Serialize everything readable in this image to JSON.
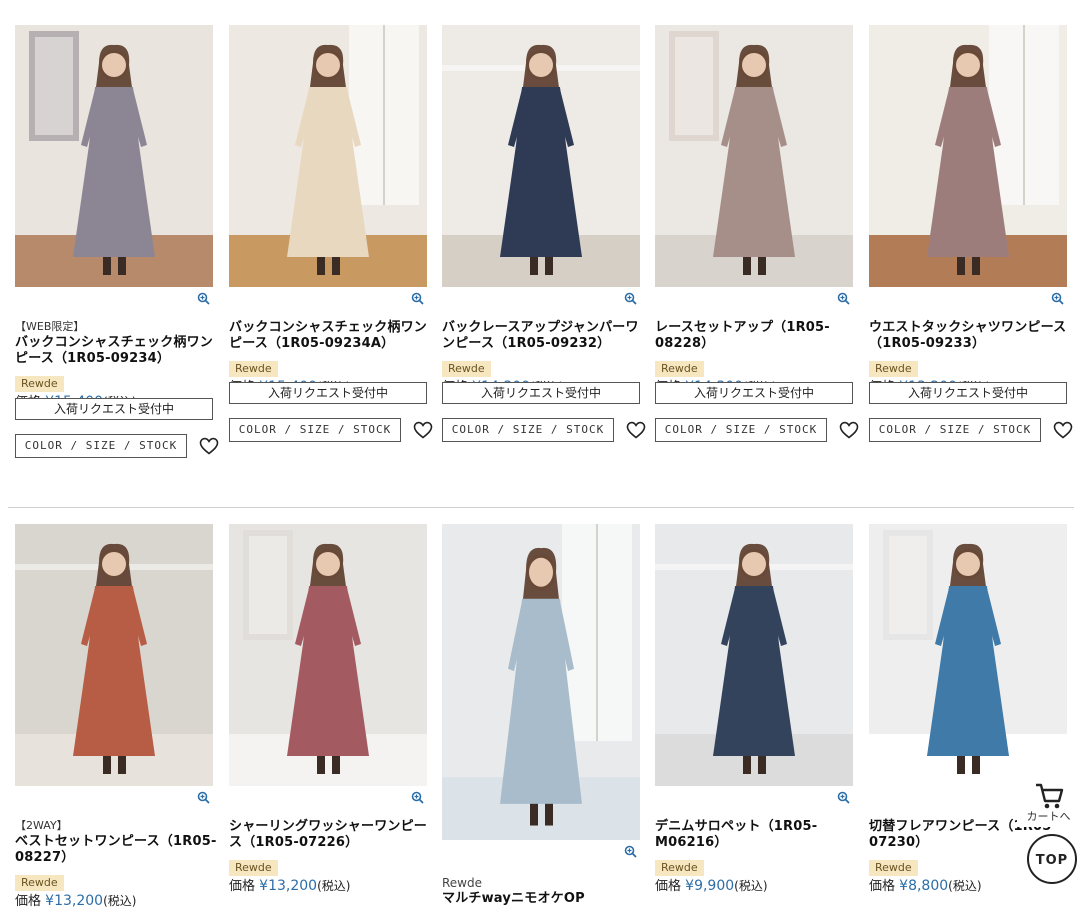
{
  "row1": [
    {
      "tag": "【WEB限定】",
      "name": "バックコンシャスチェック柄ワンピース（1R05-09234）",
      "brand": "Rewde",
      "price_prefix": "価格",
      "price": "¥15,400",
      "tax": "(税込)",
      "request": "入荷リクエスト受付中",
      "css": "COLOR / SIZE / STOCK",
      "palette": [
        "#e9e4de",
        "#8c8694",
        "#5b5060",
        "#b78a6b"
      ]
    },
    {
      "tag": "",
      "name": "バックコンシャスチェック柄ワンピース（1R05-09234A）",
      "brand": "Rewde",
      "price_prefix": "価格",
      "price": "¥15,400",
      "tax": "(税込)",
      "request": "入荷リクエスト受付中",
      "css": "COLOR / SIZE / STOCK",
      "palette": [
        "#ede8e1",
        "#e8d8bf",
        "#b59a78",
        "#c89a62"
      ]
    },
    {
      "tag": "",
      "name": "バックレースアップジャンパーワンピース（1R05-09232）",
      "brand": "Rewde",
      "price_prefix": "価格",
      "price": "¥14,300",
      "tax": "(税込)",
      "request": "入荷リクエスト受付中",
      "css": "COLOR / SIZE / STOCK",
      "palette": [
        "#eeebe6",
        "#2f3b55",
        "#a57d66",
        "#d5cfc6"
      ]
    },
    {
      "tag": "",
      "name": "レースセットアップ（1R05-08228）",
      "brand": "Rewde",
      "price_prefix": "価格",
      "price": "¥14,300",
      "tax": "(税込)",
      "request": "入荷リクエスト受付中",
      "css": "COLOR / SIZE / STOCK",
      "palette": [
        "#ebe7e2",
        "#a58f88",
        "#c9b7ae",
        "#d8d3cc"
      ]
    },
    {
      "tag": "",
      "name": "ウエストタックシャツワンピース（1R05-09233）",
      "brand": "Rewde",
      "price_prefix": "価格",
      "price": "¥13,200",
      "tax": "(税込)",
      "request": "入荷リクエスト受付中",
      "css": "COLOR / SIZE / STOCK",
      "palette": [
        "#f0ece6",
        "#9d7d7c",
        "#7d5f5d",
        "#b27d56"
      ]
    }
  ],
  "row2": [
    {
      "tag": "【2WAY】",
      "name": "ベストセットワンピース（1R05-08227）",
      "brand": "Rewde",
      "price_prefix": "価格",
      "price": "¥13,200",
      "tax": "(税込)",
      "palette": [
        "#d9d5cf",
        "#b85d45",
        "#8f8a85",
        "#e7e2dc"
      ]
    },
    {
      "tag": "",
      "name": "シャーリングワッシャーワンピース（1R05-07226）",
      "brand": "Rewde",
      "price_prefix": "価格",
      "price": "¥13,200",
      "tax": "(税込)",
      "palette": [
        "#e7e5e2",
        "#a35a60",
        "#d7d2cc",
        "#f4f3f1"
      ]
    },
    {
      "tag": "",
      "name": "マルチwayニモオケOP",
      "brand": "Rewde",
      "price_prefix": "",
      "price": "",
      "tax": "",
      "palette": [
        "#e9eaec",
        "#a9bccb",
        "#ffffff",
        "#dbe2e8"
      ]
    },
    {
      "tag": "",
      "name": "デニムサロペット（1R05-M06216）",
      "brand": "Rewde",
      "price_prefix": "価格",
      "price": "¥9,900",
      "tax": "(税込)",
      "palette": [
        "#e8e9ea",
        "#34435c",
        "#f6f1e8",
        "#dcdcdc"
      ]
    },
    {
      "tag": "",
      "name": "切替フレアワンピース（1R05-07230）",
      "brand": "Rewde",
      "price_prefix": "価格",
      "price": "¥8,800",
      "tax": "(税込)",
      "palette": [
        "#eeeeee",
        "#3f7aa8",
        "#d6d6d6",
        "#ffffff"
      ]
    }
  ],
  "floating": {
    "cart_label": "カートへ",
    "top_label": "TOP"
  }
}
